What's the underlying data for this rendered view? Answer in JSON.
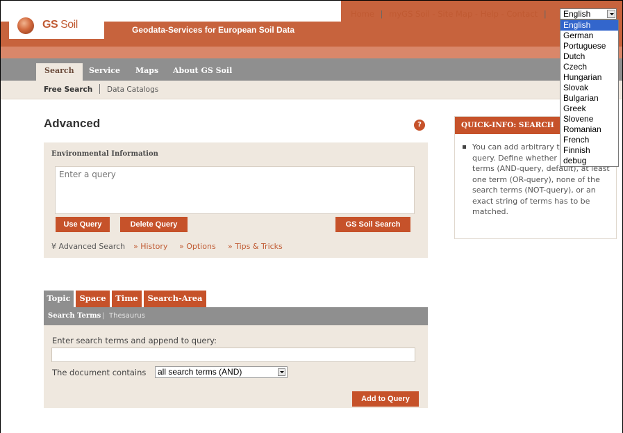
{
  "brand": {
    "logo_text_bold": "GS",
    "logo_text_rest": " Soil",
    "tagline": "Geodata-Services for European Soil Data"
  },
  "toplinks": {
    "home": "Home",
    "sep": "|",
    "mygs": "myGS Soil",
    "dash1": " - ",
    "sitemap": "Site Map",
    "dash2": " - ",
    "help": "Help",
    "dash3": " - ",
    "contact": "Contact",
    "sep2": "|"
  },
  "language": {
    "selected": "English",
    "options": [
      "English",
      "German",
      "Portuguese",
      "Dutch",
      "Czech",
      "Hungarian",
      "Slovak",
      "Bulgarian",
      "Greek",
      "Slovene",
      "Romanian",
      "French",
      "Finnish",
      "debug"
    ]
  },
  "nav": {
    "tabs": [
      "Search",
      "Service",
      "Maps",
      "About GS Soil"
    ]
  },
  "subnav": {
    "items": [
      "Free Search",
      "Data Catalogs"
    ]
  },
  "advanced": {
    "title": "Advanced",
    "help_glyph": "?",
    "section_label": "Environmental Information",
    "query_placeholder": "Enter a query",
    "buttons": {
      "use_query": "Use Query",
      "delete_query": "Delete Query",
      "gs_soil_search": "GS Soil Search"
    },
    "links": {
      "advanced_search": "¥ Advanced Search",
      "history": "» History",
      "options": "» Options",
      "tips": "» Tips & Tricks"
    }
  },
  "quick_info": {
    "title": "QUICK-INFO: SEARCH",
    "text": "You can add arbitrary terms to your query. Define whether all search terms (AND-query, default), at least one term (OR-query), none of the search terms (NOT-query), or an exact string of terms has to be matched."
  },
  "lower": {
    "tabs": [
      "Topic",
      "Space",
      "Time",
      "Search-Area"
    ],
    "subtabs": {
      "search_terms": "Search Terms",
      "sep": "|",
      "thesaurus": "Thesaurus"
    },
    "append_label": "Enter search terms and append to query:",
    "contains_label": "The document contains",
    "contains_value": "all search terms (AND)",
    "add_button": "Add to Query"
  },
  "colors": {
    "brand": "#c6522a",
    "nav_grey": "#8f8f8f",
    "panel_bg": "#efe8df",
    "link": "#c05a32"
  }
}
